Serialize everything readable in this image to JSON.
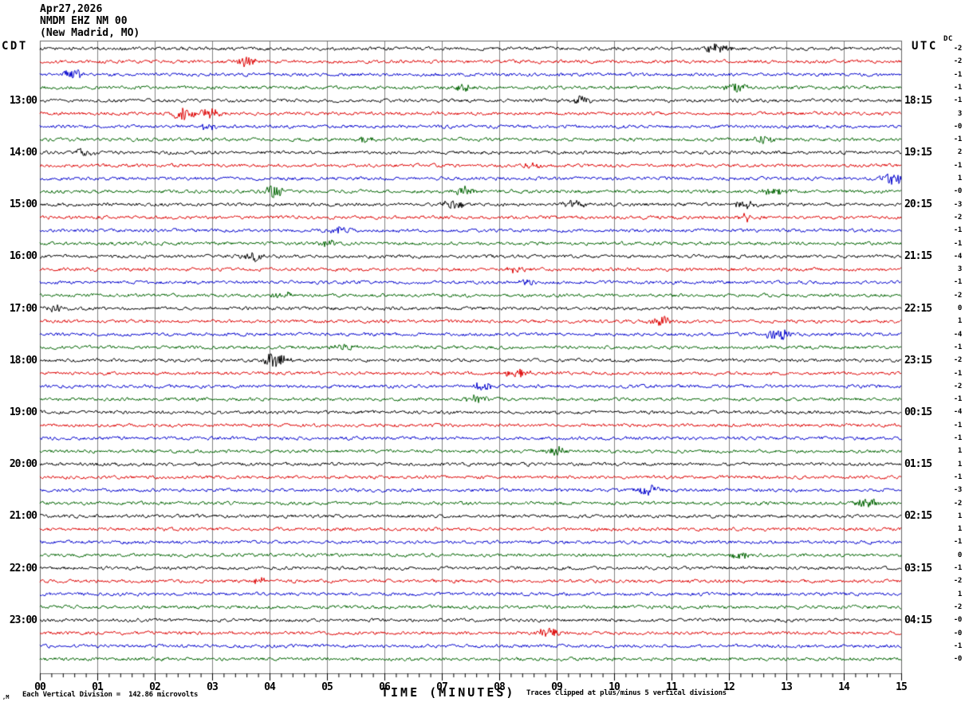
{
  "header": {
    "date": "Apr27,2026",
    "station": "NMDM EHZ NM 00",
    "location": "(New Madrid, MO)"
  },
  "corner_labels": {
    "left_tz": "CDT",
    "right_tz": "UTC",
    "dc": "DC"
  },
  "x_axis": {
    "label": "TIME (MINUTES)",
    "ticks": [
      "00",
      "01",
      "02",
      "03",
      "04",
      "05",
      "06",
      "07",
      "08",
      "09",
      "10",
      "11",
      "12",
      "13",
      "14",
      "15"
    ]
  },
  "footer": {
    "watermark": "‚M",
    "scale_note": "Each Vertical Division =  142.86 microvolts",
    "clip_note": "Traces clipped at plus/minus 5 vertical divisions"
  },
  "colors": {
    "grid": "#808080",
    "border": "#666666",
    "tick": "#000000",
    "trace_map": {
      "black": "#000000",
      "red": "#dd0000",
      "blue": "#0000cc",
      "green": "#006400"
    }
  },
  "chart_data": {
    "type": "line",
    "subtype": "helicorder-seismogram",
    "title": "NMDM EHZ NM 00 (New Madrid, MO) Apr27,2026",
    "xlabel": "TIME (MINUTES)",
    "x_range_minutes": [
      0,
      15
    ],
    "minutes_per_row": 15,
    "rows_total": 48,
    "left_timezone": "CDT",
    "right_timezone": "UTC",
    "microvolts_per_division": 142.86,
    "clip_divisions": 5,
    "left_hour_labels": [
      {
        "row": 4,
        "label": "13:00"
      },
      {
        "row": 8,
        "label": "14:00"
      },
      {
        "row": 12,
        "label": "15:00"
      },
      {
        "row": 16,
        "label": "16:00"
      },
      {
        "row": 20,
        "label": "17:00"
      },
      {
        "row": 24,
        "label": "18:00"
      },
      {
        "row": 28,
        "label": "19:00"
      },
      {
        "row": 32,
        "label": "20:00"
      },
      {
        "row": 36,
        "label": "21:00"
      },
      {
        "row": 40,
        "label": "22:00"
      },
      {
        "row": 44,
        "label": "23:00"
      }
    ],
    "right_hour_labels": [
      {
        "row": 4,
        "label": "18:15"
      },
      {
        "row": 8,
        "label": "19:15"
      },
      {
        "row": 12,
        "label": "20:15"
      },
      {
        "row": 16,
        "label": "21:15"
      },
      {
        "row": 20,
        "label": "22:15"
      },
      {
        "row": 24,
        "label": "23:15"
      },
      {
        "row": 28,
        "label": "00:15"
      },
      {
        "row": 32,
        "label": "01:15"
      },
      {
        "row": 36,
        "label": "02:15"
      },
      {
        "row": 40,
        "label": "03:15"
      },
      {
        "row": 44,
        "label": "04:15"
      }
    ],
    "rows": [
      {
        "color": "black",
        "dc": "-2",
        "events": [
          [
            11.8,
            5
          ]
        ]
      },
      {
        "color": "red",
        "dc": "-2",
        "events": [
          [
            3.6,
            4
          ]
        ]
      },
      {
        "color": "blue",
        "dc": "-1",
        "events": [
          [
            0.6,
            4
          ]
        ]
      },
      {
        "color": "green",
        "dc": "-1",
        "events": [
          [
            7.35,
            3
          ],
          [
            12.1,
            4
          ]
        ]
      },
      {
        "color": "black",
        "dc": "-1",
        "events": [
          [
            9.4,
            3
          ]
        ]
      },
      {
        "color": "red",
        "dc": "3",
        "events": [
          [
            2.5,
            5
          ],
          [
            2.95,
            4
          ]
        ]
      },
      {
        "color": "blue",
        "dc": "-0",
        "events": [
          [
            2.9,
            2.5
          ]
        ]
      },
      {
        "color": "green",
        "dc": "-1",
        "events": [
          [
            5.7,
            3
          ],
          [
            12.6,
            3
          ]
        ]
      },
      {
        "color": "black",
        "dc": "2",
        "events": [
          [
            0.75,
            4
          ]
        ]
      },
      {
        "color": "red",
        "dc": "-1",
        "events": [
          [
            8.6,
            2.5
          ]
        ]
      },
      {
        "color": "blue",
        "dc": "1",
        "events": [
          [
            14.85,
            5
          ]
        ]
      },
      {
        "color": "green",
        "dc": "-0",
        "events": [
          [
            4.05,
            5
          ],
          [
            7.4,
            4
          ],
          [
            12.8,
            3
          ]
        ]
      },
      {
        "color": "black",
        "dc": "-3",
        "events": [
          [
            7.2,
            4
          ],
          [
            9.3,
            3
          ],
          [
            12.3,
            3
          ]
        ]
      },
      {
        "color": "red",
        "dc": "-2",
        "events": [
          [
            12.3,
            3
          ]
        ]
      },
      {
        "color": "blue",
        "dc": "-1",
        "events": [
          [
            5.2,
            2.5
          ]
        ]
      },
      {
        "color": "green",
        "dc": "-1",
        "events": [
          [
            5.0,
            2.5
          ]
        ]
      },
      {
        "color": "black",
        "dc": "-4",
        "events": [
          [
            3.7,
            4
          ]
        ]
      },
      {
        "color": "red",
        "dc": "3",
        "events": [
          [
            8.3,
            3
          ]
        ]
      },
      {
        "color": "blue",
        "dc": "-1",
        "events": [
          [
            8.5,
            2.5
          ]
        ]
      },
      {
        "color": "green",
        "dc": "-2",
        "events": [
          [
            4.2,
            2.5
          ]
        ]
      },
      {
        "color": "black",
        "dc": "0",
        "events": [
          [
            0.3,
            2.5
          ]
        ]
      },
      {
        "color": "red",
        "dc": "1",
        "events": [
          [
            10.8,
            4
          ]
        ]
      },
      {
        "color": "blue",
        "dc": "-4",
        "events": [
          [
            12.85,
            5
          ]
        ]
      },
      {
        "color": "green",
        "dc": "-1",
        "events": [
          [
            5.3,
            2.5
          ]
        ]
      },
      {
        "color": "black",
        "dc": "-2",
        "events": [
          [
            4.1,
            7
          ]
        ]
      },
      {
        "color": "red",
        "dc": "-1",
        "events": [
          [
            8.3,
            4
          ]
        ]
      },
      {
        "color": "blue",
        "dc": "-2",
        "events": [
          [
            7.7,
            3
          ]
        ]
      },
      {
        "color": "green",
        "dc": "-1",
        "events": [
          [
            7.6,
            3
          ]
        ]
      },
      {
        "color": "black",
        "dc": "-4",
        "events": []
      },
      {
        "color": "red",
        "dc": "-1",
        "events": []
      },
      {
        "color": "blue",
        "dc": "-1",
        "events": []
      },
      {
        "color": "green",
        "dc": "1",
        "events": [
          [
            9.0,
            3
          ]
        ]
      },
      {
        "color": "black",
        "dc": "1",
        "events": []
      },
      {
        "color": "red",
        "dc": "-1",
        "events": []
      },
      {
        "color": "blue",
        "dc": "-3",
        "events": [
          [
            10.6,
            4
          ]
        ]
      },
      {
        "color": "green",
        "dc": "-2",
        "events": [
          [
            14.4,
            5
          ]
        ]
      },
      {
        "color": "black",
        "dc": "1",
        "events": []
      },
      {
        "color": "red",
        "dc": "1",
        "events": []
      },
      {
        "color": "blue",
        "dc": "-1",
        "events": []
      },
      {
        "color": "green",
        "dc": "0",
        "events": [
          [
            12.2,
            3
          ]
        ]
      },
      {
        "color": "black",
        "dc": "-1",
        "events": []
      },
      {
        "color": "red",
        "dc": "-2",
        "events": [
          [
            3.8,
            2.5
          ]
        ]
      },
      {
        "color": "blue",
        "dc": "1",
        "events": []
      },
      {
        "color": "green",
        "dc": "-2",
        "events": []
      },
      {
        "color": "black",
        "dc": "-0",
        "events": []
      },
      {
        "color": "red",
        "dc": "-0",
        "events": [
          [
            8.85,
            5
          ]
        ]
      },
      {
        "color": "blue",
        "dc": "-1",
        "events": []
      },
      {
        "color": "green",
        "dc": "-0",
        "events": []
      }
    ]
  }
}
